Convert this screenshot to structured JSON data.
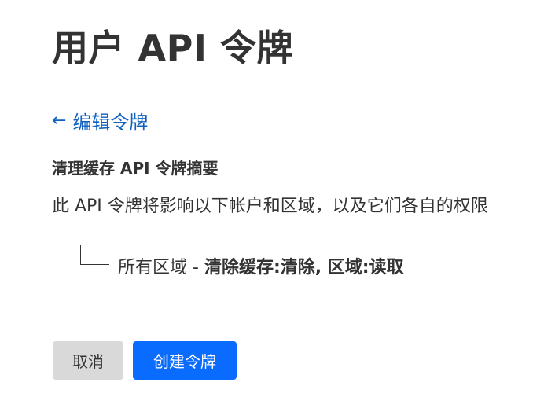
{
  "page": {
    "title": "用户 API 令牌"
  },
  "back_link": {
    "arrow": "←",
    "label": "编辑令牌"
  },
  "summary": {
    "heading": "清理缓存 API 令牌摘要",
    "description": "此 API 令牌将影响以下帐户和区域，以及它们各自的权限",
    "permission": {
      "scope": "所有区域",
      "separator": " - ",
      "permissions": "清除缓存:清除, 区域:读取"
    }
  },
  "actions": {
    "cancel_label": "取消",
    "create_label": "创建令牌"
  },
  "colors": {
    "link": "#1060c0",
    "primary_button": "#0a6cff",
    "secondary_button": "#d9d9d9"
  }
}
